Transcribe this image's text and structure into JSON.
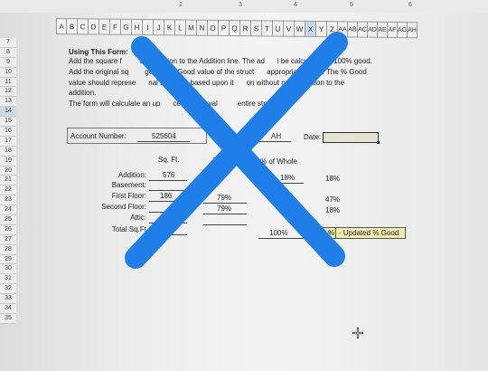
{
  "ruler": {
    "ticks": [
      "2",
      "3",
      "4",
      "5",
      "6"
    ]
  },
  "columns": [
    "A",
    "B",
    "C",
    "D",
    "E",
    "F",
    "G",
    "H",
    "I",
    "J",
    "K",
    "L",
    "M",
    "N",
    "O",
    "P",
    "Q",
    "R",
    "S",
    "T",
    "U",
    "V",
    "W",
    "X",
    "Y",
    "Z",
    "AA",
    "AB",
    "AC",
    "AD",
    "AE",
    "AF",
    "AG",
    "AH"
  ],
  "selected_column": "X",
  "rows": [
    "7",
    "8",
    "9",
    "10",
    "11",
    "12",
    "13",
    "14",
    "15",
    "16",
    "17",
    "18",
    "19",
    "20",
    "21",
    "22",
    "23",
    "24",
    "25",
    "26",
    "27",
    "28",
    "29",
    "30",
    "31",
    "32",
    "33",
    "34",
    "35"
  ],
  "selected_row": "14",
  "instructions": {
    "heading": "Using This Form:",
    "line1a": "Add the square f",
    "line1b": "the addition to the Addition line.  The ad",
    "line1c": "l be calculated at 100% good.",
    "line2a": "Add the original sq",
    "line2b": "ge and % Good value of the struct",
    "line2c": "appropriate fields.  The % Good",
    "line3a": "value should represe",
    "line3b": "nal structure based upon it",
    "line3c": "on without consideration to the",
    "line4": "addition.",
    "line5a": "The form will calculate an up",
    "line5b": "cent Good val",
    "line5c": "entire structure."
  },
  "account": {
    "label": "Account Number:",
    "value": "525604",
    "partial": "AH",
    "date_label": "Date:"
  },
  "table": {
    "header_sqft": "Sq. Ft.",
    "header_t": "t",
    "header_whole": "% of Whole",
    "rows": [
      {
        "label": "Addition:",
        "sqft": "576",
        "good": "",
        "whole": "18%",
        "pct": "18%"
      },
      {
        "label": "Basement:",
        "sqft": "",
        "good": "",
        "whole": "",
        "pct": ""
      },
      {
        "label": "First Floor:",
        "sqft": "186",
        "good": "79%",
        "whole": "",
        "pct": "47%"
      },
      {
        "label": "Second Floor:",
        "sqft": "",
        "good": "79%",
        "whole": "",
        "pct": "18%"
      },
      {
        "label": "Attic:",
        "sqft": "",
        "good": "",
        "whole": "",
        "pct": ""
      },
      {
        "label": "Total Sq.Ft",
        "sqft": "",
        "good": "",
        "whole": "100%",
        "pct": "%"
      }
    ],
    "updated_label": "- Updated % Good"
  },
  "overlay_color": "#1f7ee8",
  "icons": {
    "cursor": "crosshair-cursor-icon"
  }
}
